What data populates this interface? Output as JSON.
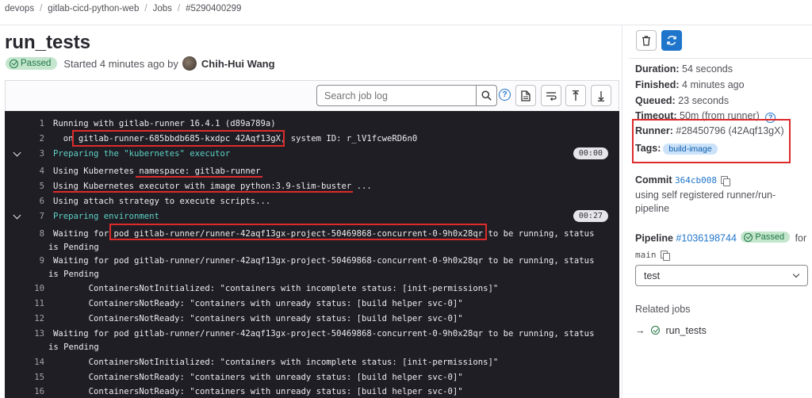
{
  "breadcrumb": [
    "devops",
    "gitlab-cicd-python-web",
    "Jobs",
    "#5290400299"
  ],
  "job": {
    "title": "run_tests",
    "status": "Passed",
    "started_text": "Started 4 minutes ago by",
    "user": "Chih-Hui Wang"
  },
  "toolbar": {
    "search_placeholder": "Search job log",
    "help_label": "?",
    "icons": [
      "search-icon",
      "help-icon",
      "raw-log-icon",
      "wrap-lines-icon",
      "scroll-top-icon",
      "scroll-bottom-icon"
    ]
  },
  "log": {
    "lines": [
      {
        "n": "1",
        "text": "Running with gitlab-runner 16.4.1 (d89a789a)"
      },
      {
        "n": "2",
        "text": "  on gitlab-runner-685bbdb685-kxdpc 42Aqf13gX, system ID: r_lV1fcweRD6n0"
      },
      {
        "n": "3",
        "text": "Preparing the \"kubernetes\" executor",
        "duration": "00:00"
      },
      {
        "n": "4",
        "text": "Using Kubernetes namespace: gitlab-runner"
      },
      {
        "n": "5",
        "text": "Using Kubernetes executor with image python:3.9-slim-buster ..."
      },
      {
        "n": "6",
        "text": "Using attach strategy to execute scripts..."
      },
      {
        "n": "7",
        "text": "Preparing environment",
        "duration": "00:27"
      },
      {
        "n": "8",
        "text": "Waiting for pod gitlab-runner/runner-42aqf13gx-project-50469868-concurrent-0-9h0x28qr to be running, status",
        "wrap": "is Pending"
      },
      {
        "n": "9",
        "text": "Waiting for pod gitlab-runner/runner-42aqf13gx-project-50469868-concurrent-0-9h0x28qr to be running, status",
        "wrap": "is Pending"
      },
      {
        "n": "10",
        "text": "       ContainersNotInitialized: \"containers with incomplete status: [init-permissions]\""
      },
      {
        "n": "11",
        "text": "       ContainersNotReady: \"containers with unready status: [build helper svc-0]\""
      },
      {
        "n": "12",
        "text": "       ContainersNotReady: \"containers with unready status: [build helper svc-0]\""
      },
      {
        "n": "13",
        "text": "Waiting for pod gitlab-runner/runner-42aqf13gx-project-50469868-concurrent-0-9h0x28qr to be running, status",
        "wrap": "is Pending"
      },
      {
        "n": "14",
        "text": "       ContainersNotInitialized: \"containers with incomplete status: [init-permissions]\""
      },
      {
        "n": "15",
        "text": "       ContainersNotReady: \"containers with unready status: [build helper svc-0]\""
      },
      {
        "n": "16",
        "text": "       ContainersNotReady: \"containers with unready status: [build helper svc-0]\""
      }
    ]
  },
  "sidebar": {
    "duration_label": "Duration:",
    "duration": "54 seconds",
    "finished_label": "Finished:",
    "finished": "4 minutes ago",
    "queued_label": "Queued:",
    "queued": "23 seconds",
    "timeout_label": "Timeout:",
    "timeout": "50m (from runner)",
    "runner_label": "Runner:",
    "runner": "#28450796 (42Aqf13gX)",
    "tags_label": "Tags:",
    "tag": "build-image",
    "commit_label": "Commit",
    "commit_sha": "364cb008",
    "commit_message": "using self registered runner/run-",
    "commit_message2": "pipeline",
    "pipeline_label": "Pipeline",
    "pipeline_id": "#1036198744",
    "pipeline_status": "Passed",
    "pipeline_for": "for",
    "branch": "main",
    "stage_select": "test",
    "related_jobs_label": "Related jobs",
    "related_job": "run_tests"
  },
  "colors": {
    "accent": "#1f75cb",
    "success": "#217645",
    "highlight": "#dd2b2b",
    "log_bg": "#1f1e24"
  }
}
